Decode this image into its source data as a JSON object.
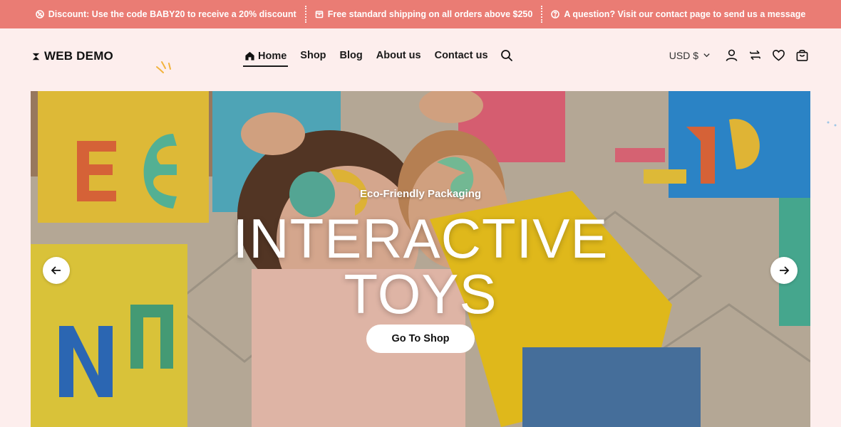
{
  "announcement": {
    "messages": [
      {
        "icon": "discount-icon",
        "text": "Discount: Use the code BABY20 to receive a 20% discount"
      },
      {
        "icon": "box-icon",
        "text": "Free standard shipping on all orders above $250"
      },
      {
        "icon": "question-icon",
        "text": "A question? Visit our contact page to send us a message"
      }
    ],
    "background": "#ea7c74"
  },
  "header": {
    "logo_text": "WEB DEMO",
    "nav": [
      {
        "label": "Home",
        "active": true,
        "icon": "home-icon"
      },
      {
        "label": "Shop"
      },
      {
        "label": "Blog"
      },
      {
        "label": "About us"
      },
      {
        "label": "Contact us"
      }
    ],
    "currency": "USD $",
    "tools": [
      "account-icon",
      "compare-icon",
      "wishlist-icon",
      "cart-icon"
    ]
  },
  "hero": {
    "kicker": "Eco-Friendly Packaging",
    "headline_line1": "INTERACTIVE",
    "headline_line2": "TOYS",
    "cta_label": "Go To Shop"
  },
  "colors": {
    "page_bg": "#fdeeed",
    "accent": "#ea7c74",
    "text": "#1c1c1c"
  }
}
